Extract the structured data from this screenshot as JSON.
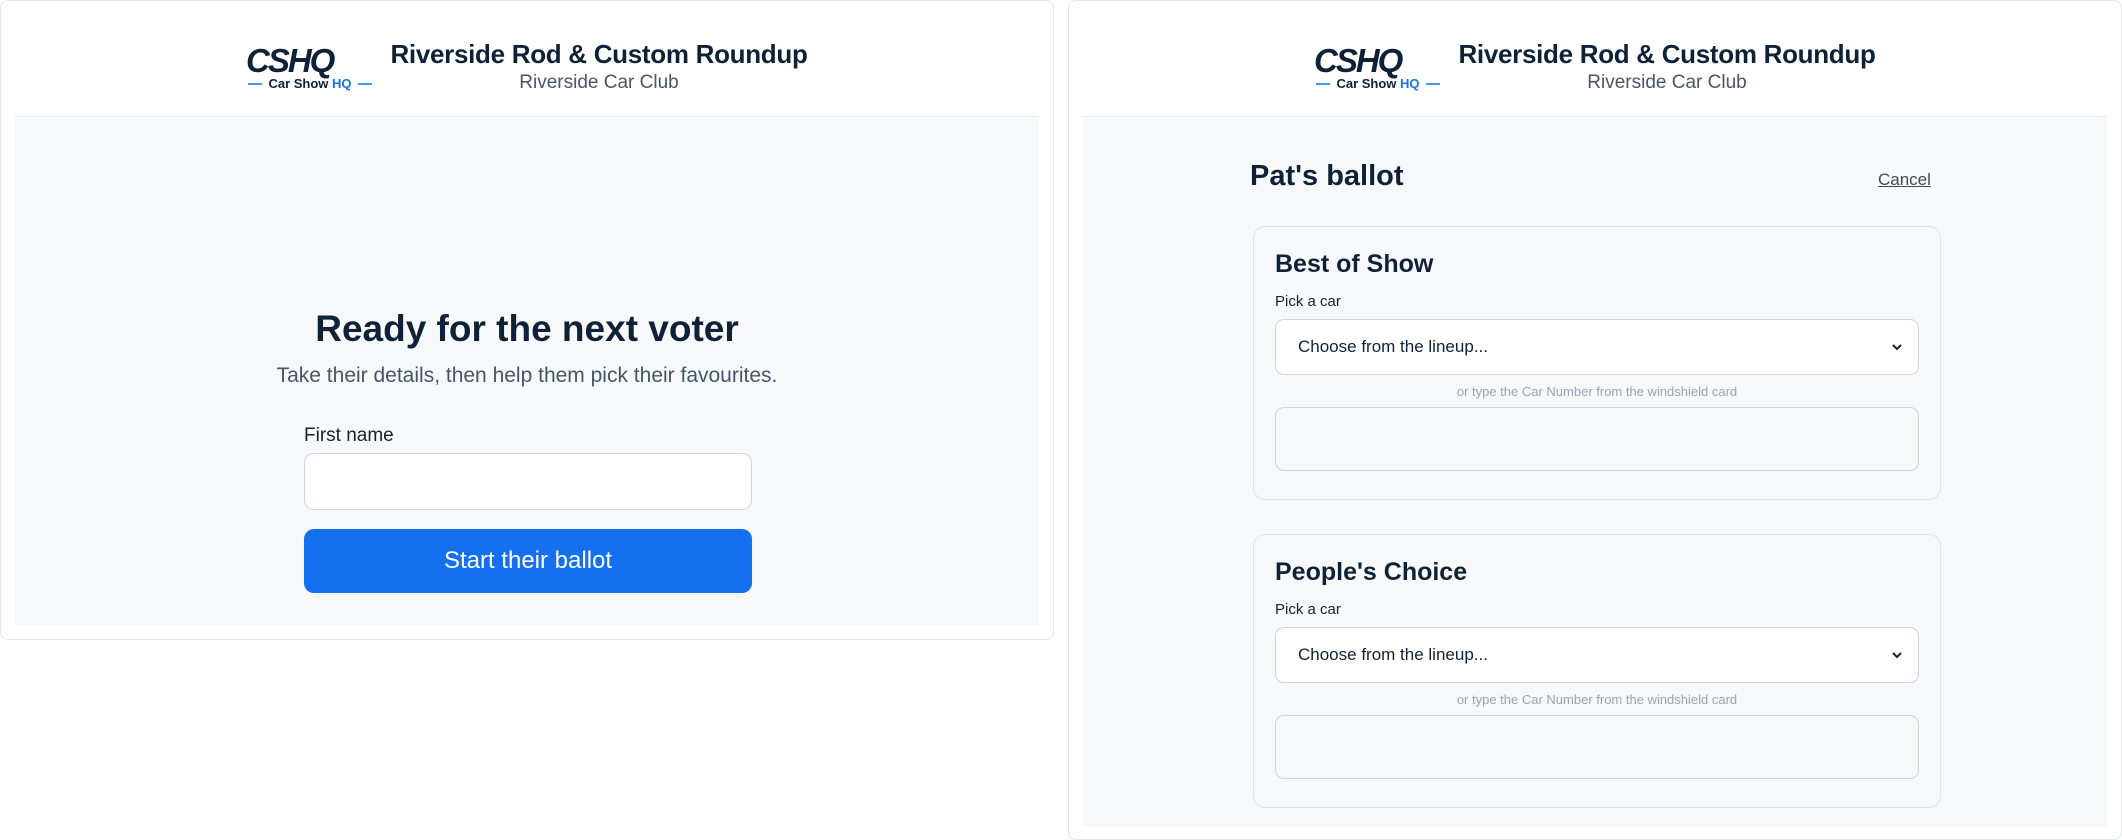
{
  "brand": {
    "logo_letters": "CSHQ",
    "logo_caption_main": "Car Show",
    "logo_caption_accent": "HQ",
    "event_title": "Riverside Rod & Custom Roundup",
    "club_name": "Riverside Car Club"
  },
  "colors": {
    "navy": "#0f2137",
    "accent_blue": "#1570ef",
    "background_gray": "#f7f8fa"
  },
  "voter_screen": {
    "title": "Ready for the next voter",
    "subtitle": "Take their details, then help them pick their favourites.",
    "first_name_label": "First name",
    "first_name_value": "",
    "start_button": "Start their ballot"
  },
  "ballot_screen": {
    "title": "Pat's ballot",
    "cancel_label": "Cancel",
    "categories": [
      {
        "title": "Best of Show",
        "pick_label": "Pick a car",
        "select_value": "Choose from the lineup...",
        "hint": "or type the Car Number from the windshield card",
        "car_number_value": ""
      },
      {
        "title": "People's Choice",
        "pick_label": "Pick a car",
        "select_value": "Choose from the lineup...",
        "hint": "or type the Car Number from the windshield card",
        "car_number_value": ""
      }
    ]
  }
}
